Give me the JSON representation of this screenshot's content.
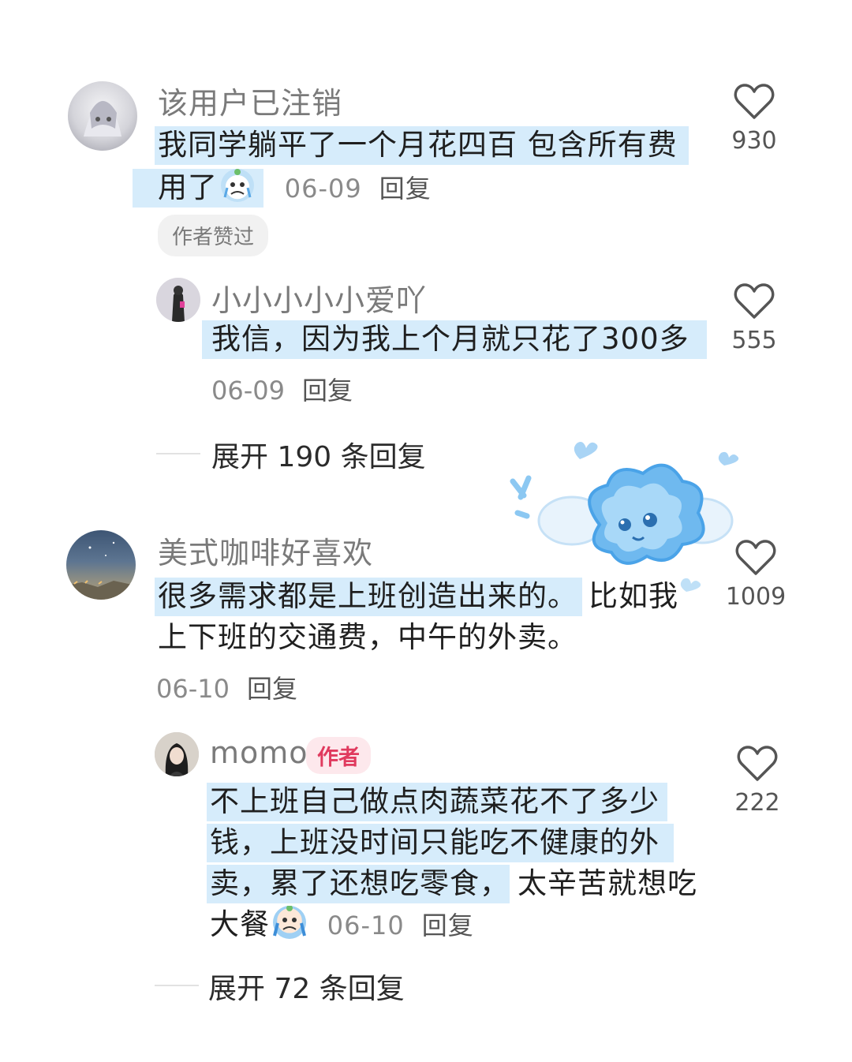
{
  "comments": [
    {
      "username": "该用户已注销",
      "lines": [
        "我同学躺平了一个月花四百 包含所有费",
        "用了"
      ],
      "date": "06-09",
      "reply_label": "回复",
      "likes": "930",
      "liked_by_author": "作者赞过",
      "replies": [
        {
          "username": "小小小小小爱吖",
          "lines": [
            "我信，因为我上个月就只花了300多"
          ],
          "date": "06-09",
          "reply_label": "回复",
          "likes": "555"
        }
      ],
      "expand_label": "展开 190 条回复"
    },
    {
      "username": "美式咖啡好喜欢",
      "lines": [
        "很多需求都是上班创造出来的。",
        "比如我",
        "上下班的交通费，中午的外卖。"
      ],
      "date": "06-10",
      "reply_label": "回复",
      "likes": "1009",
      "replies": [
        {
          "username": "momo",
          "author_badge": "作者",
          "lines": [
            "不上班自己做点肉蔬菜花不了多少",
            "钱，上班没时间只能吃不健康的外",
            "卖，累了还想吃零食，",
            "太辛苦就想吃",
            "大餐"
          ],
          "date": "06-10",
          "reply_label": "回复",
          "likes": "222"
        }
      ],
      "expand_label": "展开 72 条回复"
    }
  ],
  "icons": {
    "like": "heart-outline-icon",
    "emoji1": "crying-emoji-icon",
    "emoji2": "crying-emoji-icon",
    "sticker": "blue-cloud-sticker"
  },
  "colors": {
    "highlight": "#d6ecfb",
    "author_badge": "#e03a5e",
    "muted": "#7a7a7a"
  }
}
